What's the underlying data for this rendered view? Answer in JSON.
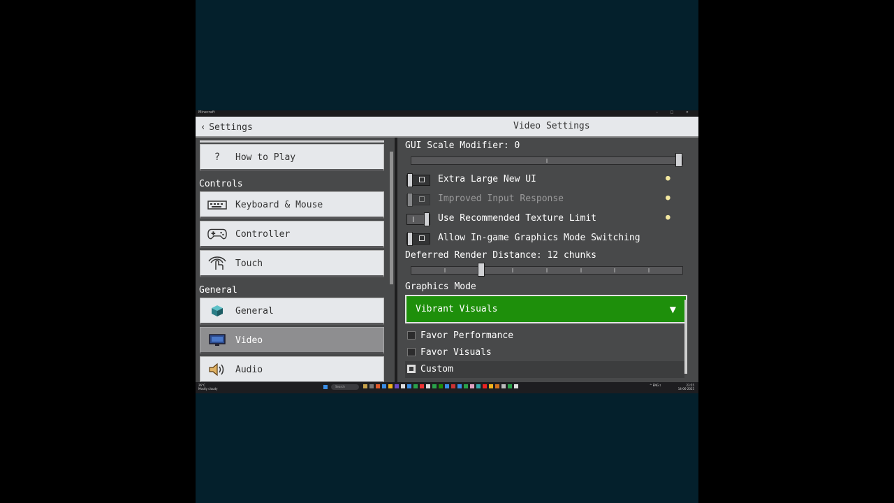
{
  "window": {
    "title": "Minecraft",
    "controls": "– □ ×"
  },
  "header": {
    "back_label": "Settings",
    "title": "Video Settings"
  },
  "sidebar": {
    "items": [
      {
        "label": "How to Play",
        "icon": "question-icon"
      },
      {
        "label": "Keyboard & Mouse",
        "icon": "keyboard-icon"
      },
      {
        "label": "Controller",
        "icon": "gamepad-icon"
      },
      {
        "label": "Touch",
        "icon": "touch-hand-icon"
      },
      {
        "label": "General",
        "icon": "grass-block-icon"
      },
      {
        "label": "Video",
        "icon": "monitor-icon",
        "active": true
      },
      {
        "label": "Audio",
        "icon": "speaker-icon"
      }
    ],
    "sections": {
      "controls": "Controls",
      "general": "General"
    },
    "question_glyph": "?"
  },
  "content": {
    "gui_scale_label": "GUI Scale Modifier: 0",
    "gui_scale_value": 1.0,
    "toggles": [
      {
        "label": "Extra Large New UI",
        "state": "off",
        "disabled": false,
        "info": true
      },
      {
        "label": "Improved Input Response",
        "state": "off",
        "disabled": true,
        "info": true
      },
      {
        "label": "Use Recommended Texture Limit",
        "state": "on",
        "disabled": false,
        "info": true
      },
      {
        "label": "Allow In-game Graphics Mode Switching",
        "state": "off",
        "disabled": false,
        "info": false
      }
    ],
    "render_distance_label": "Deferred Render Distance: 12 chunks",
    "render_distance_value": 0.25,
    "graphics_mode_label": "Graphics Mode",
    "graphics_mode_value": "Vibrant Visuals",
    "graphics_mode_options": [
      {
        "label": "Favor Performance",
        "selected": false
      },
      {
        "label": "Favor Visuals",
        "selected": false
      },
      {
        "label": "Custom",
        "selected": true
      }
    ]
  },
  "taskbar": {
    "weather": "26°C\nMostly cloudy",
    "search_placeholder": "Search",
    "tray": "^ ENG ⟟",
    "clock": "23:55\n14-06-2025"
  },
  "colors": {
    "accent_green": "#1e8f0b",
    "panel": "#48494a",
    "header": "#e6e8eb"
  }
}
